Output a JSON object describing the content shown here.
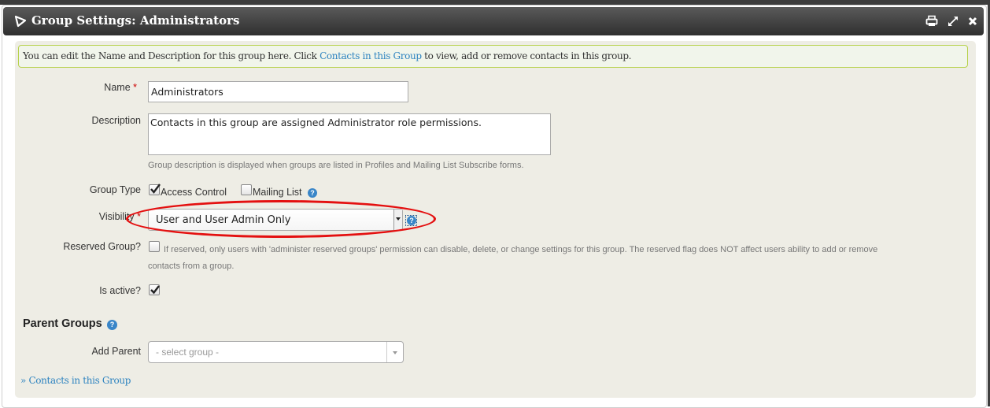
{
  "dialog": {
    "title": "Group Settings: Administrators",
    "toolbar": {
      "icons": [
        "print-icon",
        "fullscreen-icon",
        "close-icon"
      ]
    }
  },
  "notice": {
    "text_before": "You can edit the Name and Description for this group here. Click ",
    "link_text": "Contacts in this Group",
    "text_after": " to view, add or remove contacts in this group."
  },
  "form": {
    "name": {
      "label": "Name",
      "required_marker": "*",
      "value": "Administrators"
    },
    "description": {
      "label": "Description",
      "value": "Contacts in this group are assigned Administrator role permissions.",
      "help": "Group description is displayed when groups are listed in Profiles and Mailing List Subscribe forms."
    },
    "group_type": {
      "label": "Group Type",
      "options": [
        {
          "label": "Access Control",
          "checked": true
        },
        {
          "label": "Mailing List",
          "checked": false
        }
      ]
    },
    "visibility": {
      "label": "Visibility",
      "required_marker": "*",
      "selected": "User and User Admin Only"
    },
    "reserved": {
      "label": "Reserved Group?",
      "checked": false,
      "help_line1": "If reserved, only users with 'administer reserved groups' permission can disable, delete, or change settings for this group. The reserved flag does NOT affect users ability to add or remove",
      "help_line2": "contacts from a group."
    },
    "is_active": {
      "label": "Is active?",
      "checked": true
    }
  },
  "parent_groups": {
    "heading": "Parent Groups",
    "add_parent_label": "Add Parent",
    "placeholder": "- select group -"
  },
  "footer_link": "» Contacts in this Group",
  "colors": {
    "accent_link": "#2f84c0",
    "notice_border": "#b7d24c",
    "annotation": "#e41010",
    "help_icon": "#3a86c8"
  }
}
